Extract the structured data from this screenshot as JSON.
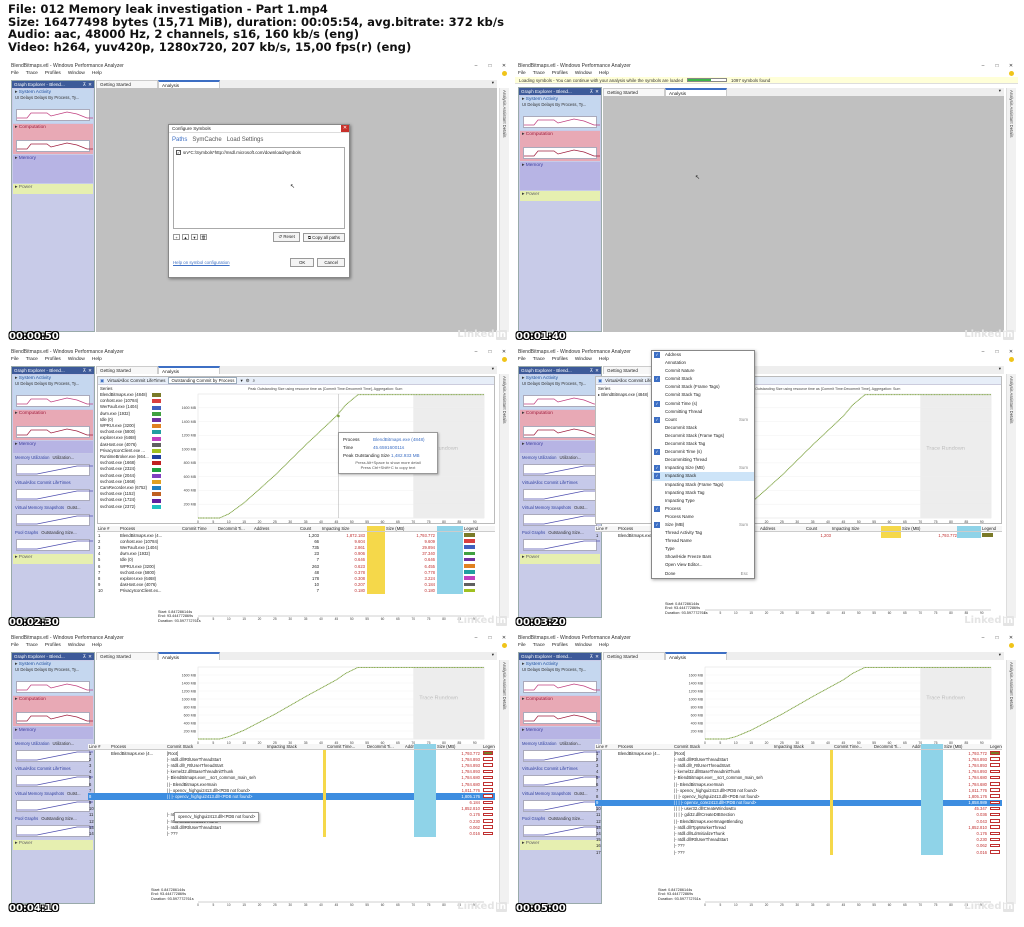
{
  "header": {
    "file": "File: 012 Memory leak investigation - Part 1.mp4",
    "size": "Size: 16477498 bytes (15,71 MiB), duration: 00:05:54, avg.bitrate: 372 kb/s",
    "audio": "Audio: aac, 48000 Hz, 2 channels, s16, 160 kb/s (eng)",
    "video": "Video: h264, yuv420p, 1280x720, 207 kb/s, 15,00 fps(r) (eng)"
  },
  "colors": {
    "accent": "#3d6fc4",
    "series_line": "#7aa03c",
    "selection": "#3d8de0"
  },
  "app": {
    "window_title_a": "BlendBitmaps.etl - Windows Performance Analyzer",
    "window_title_b": "BlendBitmaps.etl - Windows Performance Analyzer",
    "menu": [
      "File",
      "Trace",
      "Profiles",
      "Window",
      "Help"
    ],
    "graph_explorer": "Graph Explorer - Blend...",
    "groups": {
      "system_activity": "System Activity",
      "system_activity_sub": "UI Delays  Delays By Process, Ty...",
      "computation": "Computation",
      "memory": "Memory",
      "power": "Power",
      "memory_utilization": "Memory Utilization",
      "memory_utilization_tab": "Utilization...",
      "virtualalloc": "VirtualAlloc Commit LifeTimes",
      "virtual_memory_snapshots": "Virtual Memory Snapshots",
      "virtual_memory_snapshots_tab": "Outst...",
      "pool_graphs": "Pool Graphs",
      "pool_graphs_tab": "Outstanding Size..."
    },
    "tabs": {
      "getting_started": "Getting Started",
      "analysis": "Analysis"
    },
    "side_labels": "Analysis Assistant   Details",
    "timestamps": [
      "00:00:50",
      "00:01:40",
      "00:02:30",
      "00:03:20",
      "00:04:10",
      "00:05:00"
    ],
    "watermark": "Linked",
    "watermark_in": "in"
  },
  "configure_symbols": {
    "title": "Configure Symbols",
    "tabs": [
      "Paths",
      "SymCache",
      "Load Settings"
    ],
    "path_entry": "srv*C:\\Symbols*http://msdl.microsoft.com/download/symbols",
    "reset": "Reset",
    "copy_all_paths": "Copy all paths",
    "help_link": "Help on symbol configuration",
    "ok": "OK",
    "cancel": "Cancel"
  },
  "loading_bar": {
    "text": "Loading symbols - You can continue with your analysis while the symbols are loaded",
    "progress": 0.6,
    "count": "1097 symbols found"
  },
  "chart_header": {
    "title": "VirtualAlloc Commit LifeTimes",
    "preset": "Outstanding Commit by Process",
    "caption": "Peak Outstanding Size using resource time as [Commit Time:Decommit Time], Aggregation: Sum",
    "series_label": "Series",
    "trace_rundown": "Trace Rundown"
  },
  "tooltip": {
    "process_label": "Process",
    "process_value": "BlendBitmaps.exe (4848)",
    "time_label": "Time",
    "time_value": "45.659160011s",
    "peak_label": "Peak Outstanding Size",
    "peak_value": "1,482.933 MB",
    "hint1": "Press Alt+Space to show more detail",
    "hint2": "Press Ctrl+Shift+C to copy text"
  },
  "series_list": [
    {
      "name": "BlendBitmaps.exe (4848)",
      "color": "#7a7a28"
    },
    {
      "name": "conhost.exe (10784)",
      "color": "#d94040"
    },
    {
      "name": "WerFault.exe (1404)",
      "color": "#4060c0"
    },
    {
      "name": "dwm.exe (1932)",
      "color": "#40a040"
    },
    {
      "name": "Idle (0)",
      "color": "#7030a0"
    },
    {
      "name": "WPRUI.exe (3200)",
      "color": "#e08020"
    },
    {
      "name": "svchost.exe (5800)",
      "color": "#20a0a0"
    },
    {
      "name": "explorer.exe (6468)",
      "color": "#c040c0"
    },
    {
      "name": "dasHost.exe (4076)",
      "color": "#606060"
    },
    {
      "name": "PrivacyIconClient.exe ...",
      "color": "#a0c020"
    },
    {
      "name": "RuntimeBroker.exe (664...",
      "color": "#2040a0"
    },
    {
      "name": "svchost.exe (1668)",
      "color": "#c02020"
    },
    {
      "name": "svchost.exe (2324)",
      "color": "#20a040"
    },
    {
      "name": "svchost.exe (2044)",
      "color": "#8040c0"
    },
    {
      "name": "svchost.exe (1668)",
      "color": "#e0a020"
    },
    {
      "name": "CamRecorder.exe (6752)",
      "color": "#2080c0"
    },
    {
      "name": "svchost.exe (1152)",
      "color": "#c06020"
    },
    {
      "name": "svchost.exe (1724)",
      "color": "#6020a0"
    },
    {
      "name": "svchost.exe (2372)",
      "color": "#20c0c0"
    }
  ],
  "chart_data": {
    "type": "line",
    "title": "",
    "xlabel": "",
    "ylabel": "",
    "y_ticks": [
      "1600 MB",
      "1400 MB",
      "1200 MB",
      "1000 MB",
      "800 MB",
      "600 MB",
      "400 MB",
      "200 MB"
    ],
    "x_ticks": [
      "0",
      "5",
      "10",
      "15",
      "20",
      "25",
      "30",
      "35",
      "40",
      "45",
      "50",
      "55",
      "60",
      "65",
      "70",
      "75",
      "80",
      "85",
      "90"
    ],
    "ylim": [
      0,
      1800
    ],
    "xlim": [
      0,
      93
    ],
    "series": [
      {
        "values_x": [
          0,
          7,
          10,
          15,
          20,
          25,
          30,
          35,
          40,
          45,
          48,
          52,
          60,
          70,
          80,
          90,
          93
        ],
        "values_y": [
          0,
          0,
          60,
          220,
          420,
          620,
          840,
          1060,
          1270,
          1480,
          1640,
          1790,
          1790,
          1790,
          1790,
          1790,
          1790
        ]
      }
    ],
    "trace_rundown_start": 70
  },
  "grid_a": {
    "headers": [
      "Line #",
      "Process",
      "Commit Time",
      "Decommit Ti...",
      "Address",
      "Count",
      "Impacting Size",
      "Size (MB)",
      "Legend"
    ],
    "sum_label": "Sum",
    "rows": [
      {
        "line": "1",
        "process": "BlendBitmaps.exe (4...",
        "count": "1,203",
        "impacting": "1,872.183",
        "size": "1,793.772",
        "color": "#7a7a28"
      },
      {
        "line": "2",
        "process": "conhost.exe (10784)",
        "count": "66",
        "impacting": "9.604",
        "size": "9.609",
        "color": "#d94040"
      },
      {
        "line": "3",
        "process": "WerFault.exe (1404)",
        "count": "735",
        "impacting": "2.861",
        "size": "29.894",
        "color": "#4060c0"
      },
      {
        "line": "4",
        "process": "dwm.exe (1932)",
        "count": "23",
        "impacting": "0.906",
        "size": "37.340",
        "color": "#40a040"
      },
      {
        "line": "5",
        "process": "Idle (0)",
        "count": "7",
        "impacting": "0.646",
        "size": "0.646",
        "color": "#7030a0"
      },
      {
        "line": "6",
        "process": "WPRUI.exe (3200)",
        "count": "263",
        "impacting": "0.623",
        "size": "6.455",
        "color": "#e08020"
      },
      {
        "line": "7",
        "process": "svchost.exe (5800)",
        "count": "48",
        "impacting": "0.378",
        "size": "0.778",
        "color": "#20a0a0"
      },
      {
        "line": "8",
        "process": "explorer.exe (6468)",
        "count": "178",
        "impacting": "0.308",
        "size": "3.224",
        "color": "#c040c0"
      },
      {
        "line": "9",
        "process": "dasHost.exe (4076)",
        "count": "10",
        "impacting": "0.207",
        "size": "0.184",
        "color": "#606060"
      },
      {
        "line": "10",
        "process": "PrivacyIconClient.ex...",
        "count": "7",
        "impacting": "0.180",
        "size": "0.180",
        "color": "#a0c020"
      }
    ]
  },
  "selection_info": {
    "start_label": "Start:",
    "start": "0.847286144s",
    "end_label": "End:",
    "end": "93.444772869s",
    "duration_label": "Duration:",
    "duration": "93.597772761s"
  },
  "grid_b": {
    "headers": [
      "Line #",
      "Process",
      "Commit Time...",
      "Decommit Ti...",
      "Address",
      "Count",
      "Impacting Size",
      "Size (MB)",
      "Legend"
    ],
    "row": {
      "line": "1",
      "process": "BlendBitmaps.exe",
      "count": "1,203",
      "size": "1,793.772"
    }
  },
  "column_menu": [
    {
      "label": "Address",
      "checked": true
    },
    {
      "label": "Annotation",
      "checked": false
    },
    {
      "label": "Commit Nature",
      "checked": false
    },
    {
      "label": "Commit Stack",
      "checked": true
    },
    {
      "label": "Commit Stack (Frame Tags)",
      "checked": false
    },
    {
      "label": "Commit Stack Tag",
      "checked": false
    },
    {
      "label": "Commit Time (s)",
      "checked": true
    },
    {
      "label": "Committing Thread",
      "checked": false
    },
    {
      "label": "Count",
      "checked": true,
      "shortcut": "Sum"
    },
    {
      "label": "Decommit Stack",
      "checked": false
    },
    {
      "label": "Decommit Stack (Frame Tags)",
      "checked": false
    },
    {
      "label": "Decommit Stack Tag",
      "checked": false
    },
    {
      "label": "Decommit Time (s)",
      "checked": true
    },
    {
      "label": "Decommitting Thread",
      "checked": false
    },
    {
      "label": "Impacting Size (MB)",
      "checked": true,
      "shortcut": "Sum"
    },
    {
      "label": "Impacting Stack",
      "checked": true,
      "highlight": true
    },
    {
      "label": "Impacting Stack (Frame Tags)",
      "checked": false
    },
    {
      "label": "Impacting Stack Tag",
      "checked": false
    },
    {
      "label": "Impacting Type",
      "checked": false
    },
    {
      "label": "Process",
      "checked": true
    },
    {
      "label": "Process Name",
      "checked": false
    },
    {
      "label": "Size (MB)",
      "checked": true,
      "shortcut": "Sum"
    },
    {
      "label": "Thread Activity Tag",
      "checked": false
    },
    {
      "label": "Thread Name",
      "checked": false
    },
    {
      "label": "Type",
      "checked": false
    },
    {
      "label": "Show/Hide Freeze Bars",
      "checked": false
    },
    {
      "label": "Open View Editor...",
      "checked": false
    },
    {
      "label": "Done",
      "checked": false,
      "shortcut": "Esc"
    }
  ],
  "stack_grid": {
    "headers": [
      "Line #",
      "Process",
      "Commit Stack",
      "Impacting Stack",
      "Commit Time...",
      "Decommit Ti...",
      "Addr",
      "Size (MB)",
      "Legend"
    ],
    "sum_label": "Sum",
    "tooltip": "opencv_highgui2413.dll!<PDB not found>",
    "rows_e": [
      {
        "line": "1",
        "process": "BlendBitmaps.exe (4...",
        "stack": "[Root]",
        "size": "1,793.772",
        "sel": false
      },
      {
        "line": "2",
        "process": "",
        "stack": "|- ntdll.dll!RtlUserThreadStart",
        "size": "1,784.893",
        "sel": false
      },
      {
        "line": "3",
        "process": "",
        "stack": "|- ntdll.dll!_RtlUserThreadStart",
        "size": "1,784.893",
        "sel": false
      },
      {
        "line": "4",
        "process": "",
        "stack": "|- kernel32.dll!BaseThreadInitThunk",
        "size": "1,784.893",
        "sel": false
      },
      {
        "line": "5",
        "process": "",
        "stack": "|- BlendBitmaps.exe!__scrt_common_main_seh",
        "size": "1,784.680",
        "sel": false
      },
      {
        "line": "6",
        "process": "",
        "stack": "|  |- BlendBitmaps.exe!main",
        "size": "1,784.680",
        "sel": false
      },
      {
        "line": "7",
        "process": "",
        "stack": "|  |- opencv_highgui2413.dll!<PDB not found>",
        "size": "1,811.776",
        "sel": false
      },
      {
        "line": "8",
        "process": "",
        "stack": "|  |  |- opencv_highgui2413.dll!<PDB not found>",
        "size": "1,805.176",
        "sel": true
      },
      {
        "line": "9",
        "process": "",
        "stack": "",
        "size": "6.184",
        "sel": false
      },
      {
        "line": "10",
        "process": "",
        "stack": "",
        "size": "1,852.810",
        "sel": false
      },
      {
        "line": "11",
        "process": "",
        "stack": "|- ntdll.dll!TppWorkerThread",
        "size": "0.176",
        "sel": false
      },
      {
        "line": "12",
        "process": "",
        "stack": "|- ntdll.dll!LdrInitializeThunk",
        "size": "0.230",
        "sel": false
      },
      {
        "line": "13",
        "process": "",
        "stack": "|- ntdll.dll!RtlUserThreadStart",
        "size": "0.062",
        "sel": false
      },
      {
        "line": "14",
        "process": "",
        "stack": "|- ???",
        "size": "0.016",
        "sel": false
      }
    ],
    "rows_f": [
      {
        "line": "1",
        "process": "BlendBitmaps.exe (4...",
        "stack": "[Root]",
        "size": "1,793.772",
        "sel": false
      },
      {
        "line": "2",
        "process": "",
        "stack": "|- ntdll.dll!RtlUserThreadStart",
        "size": "1,784.893",
        "sel": false
      },
      {
        "line": "3",
        "process": "",
        "stack": "|- ntdll.dll!_RtlUserThreadStart",
        "size": "1,784.893",
        "sel": false
      },
      {
        "line": "4",
        "process": "",
        "stack": "|- kernel32.dll!BaseThreadInitThunk",
        "size": "1,784.893",
        "sel": false
      },
      {
        "line": "5",
        "process": "",
        "stack": "|- BlendBitmaps.exe!__scrt_common_main_seh",
        "size": "1,784.680",
        "sel": false
      },
      {
        "line": "6",
        "process": "",
        "stack": "|  |- BlendBitmaps.exe!main",
        "size": "1,784.680",
        "sel": false
      },
      {
        "line": "7",
        "process": "",
        "stack": "|  |- opencv_highgui2413.dll!<PDB not found>",
        "size": "1,811.776",
        "sel": false
      },
      {
        "line": "8",
        "process": "",
        "stack": "|  |  |- opencv_highgui2413.dll!<PDB not found>",
        "size": "1,805.176",
        "sel": false
      },
      {
        "line": "9",
        "process": "",
        "stack": "|  |  |  |- opencv_core2413.dll!<PDB not found>",
        "size": "1,858.989",
        "sel": true
      },
      {
        "line": "10",
        "process": "",
        "stack": "|  |  |  |- user32.dll!CreateWindowEx",
        "size": "45.347",
        "sel": false
      },
      {
        "line": "11",
        "process": "",
        "stack": "|  |  |  |- gdi32.dll!CreateDIBSection",
        "size": "0.036",
        "sel": false
      },
      {
        "line": "12",
        "process": "",
        "stack": "|  |- BlendBitmaps.exe!ImageBlending",
        "size": "0.043",
        "sel": false
      },
      {
        "line": "13",
        "process": "",
        "stack": "|- ntdll.dll!TppWorkerThread",
        "size": "1,852.810",
        "sel": false
      },
      {
        "line": "14",
        "process": "",
        "stack": "|- ntdll.dll!LdrInitializeThunk",
        "size": "0.176",
        "sel": false
      },
      {
        "line": "15",
        "process": "",
        "stack": "|- ntdll.dll!RtlUserThreadStart",
        "size": "0.230",
        "sel": false
      },
      {
        "line": "16",
        "process": "",
        "stack": "|- ???",
        "size": "0.062",
        "sel": false
      },
      {
        "line": "17",
        "process": "",
        "stack": "|- ???",
        "size": "0.016",
        "sel": false
      }
    ]
  }
}
